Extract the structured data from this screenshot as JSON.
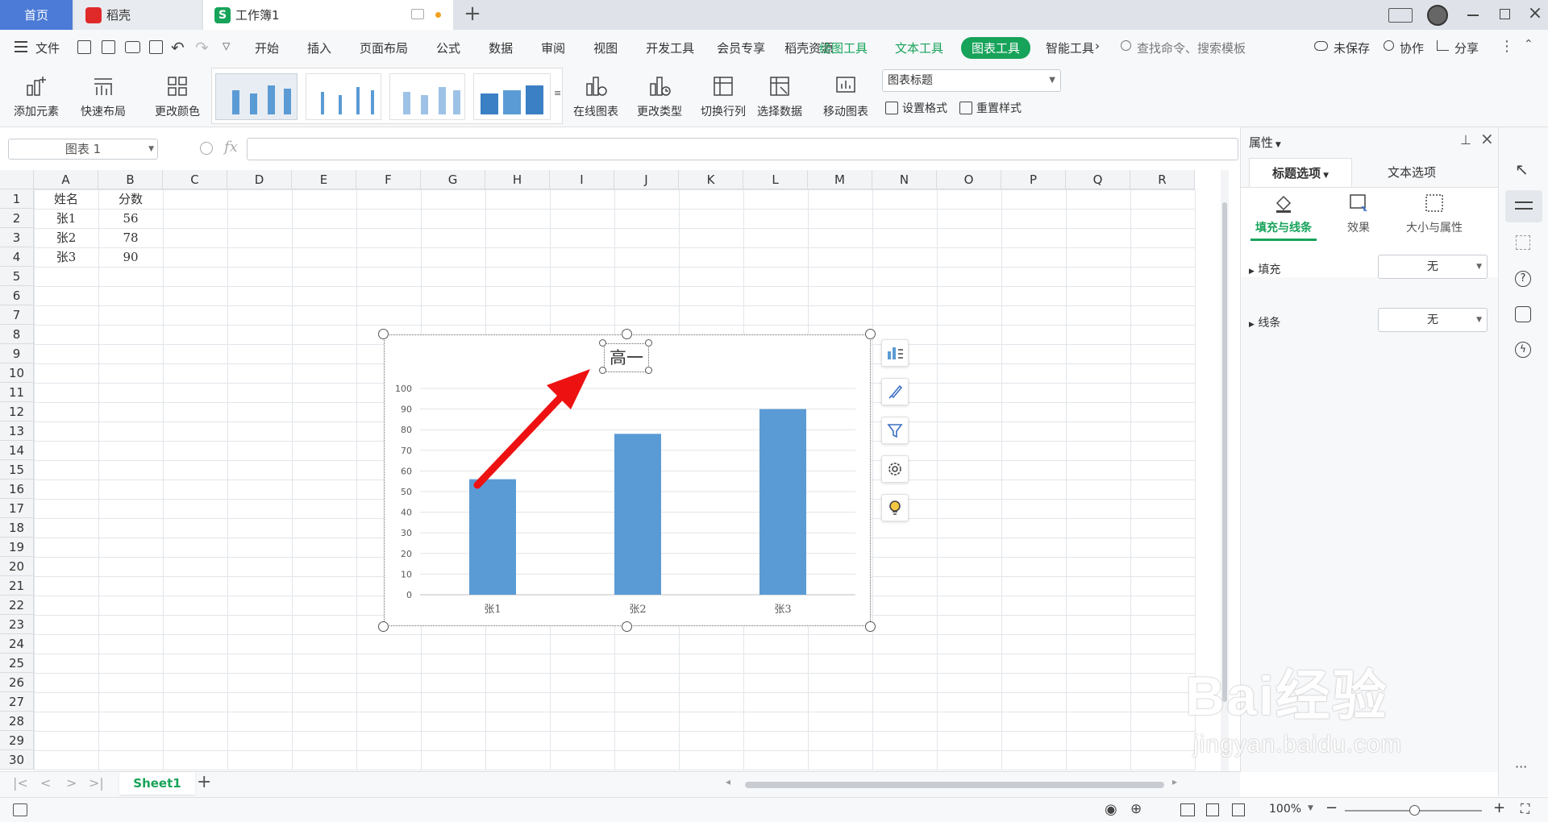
{
  "tabs": {
    "home": "首页",
    "daoke": "稻壳",
    "workbook": "工作簿1"
  },
  "menu": {
    "file": "文件",
    "items": [
      "开始",
      "插入",
      "页面布局",
      "公式",
      "数据",
      "审阅",
      "视图",
      "开发工具",
      "会员专享",
      "稻壳资源"
    ],
    "draw_tools": "绘图工具",
    "text_tools": "文本工具",
    "chart_tools": "图表工具",
    "smart_tools": "智能工具",
    "search_placeholder": "查找命令、搜索模板",
    "unsaved": "未保存",
    "collab": "协作",
    "share": "分享"
  },
  "ribbon": {
    "add_element": "添加元素",
    "quick_layout": "快速布局",
    "change_color": "更改颜色",
    "online_chart": "在线图表",
    "change_type": "更改类型",
    "switch_row_col": "切换行列",
    "select_data": "选择数据",
    "move_chart": "移动图表",
    "element_select": "图表标题",
    "set_format": "设置格式",
    "reset_style": "重置样式"
  },
  "formula": {
    "name_box": "图表 1",
    "fx": "fx",
    "value": ""
  },
  "grid": {
    "columns": [
      "A",
      "B",
      "C",
      "D",
      "E",
      "F",
      "G",
      "H",
      "I",
      "J",
      "K",
      "L",
      "M",
      "N",
      "O",
      "P",
      "Q",
      "R"
    ],
    "rows": [
      "1",
      "2",
      "3",
      "4",
      "5",
      "6",
      "7",
      "8",
      "9",
      "10",
      "11",
      "12",
      "13",
      "14",
      "15",
      "16",
      "17",
      "18",
      "19",
      "20",
      "21",
      "22",
      "23",
      "24",
      "25",
      "26",
      "27",
      "28",
      "29",
      "30"
    ],
    "cells": [
      [
        "姓名",
        "分数"
      ],
      [
        "张1",
        "56"
      ],
      [
        "张2",
        "78"
      ],
      [
        "张3",
        "90"
      ]
    ]
  },
  "chart_data": {
    "type": "bar",
    "title": "高一",
    "categories": [
      "张1",
      "张2",
      "张3"
    ],
    "values": [
      56,
      78,
      90
    ],
    "ylim": [
      0,
      100
    ],
    "yticks": [
      "0",
      "10",
      "20",
      "30",
      "40",
      "50",
      "60",
      "70",
      "80",
      "90",
      "100"
    ],
    "grid": true,
    "bar_color": "#5b9bd5"
  },
  "panel": {
    "title": "属性",
    "tab_title_options": "标题选项",
    "tab_text_options": "文本选项",
    "sub_fill_line": "填充与线条",
    "sub_effect": "效果",
    "sub_size": "大小与属性",
    "fill_label": "填充",
    "fill_value": "无",
    "line_label": "线条",
    "line_value": "无"
  },
  "sheet": {
    "name": "Sheet1"
  },
  "status": {
    "zoom": "100%"
  },
  "watermark": {
    "text": "Bai经验",
    "url": "jingyan.baidu.com"
  },
  "colors": {
    "accent": "#17a35a",
    "bar": "#5b9bd5",
    "arrow": "#ee1111"
  }
}
